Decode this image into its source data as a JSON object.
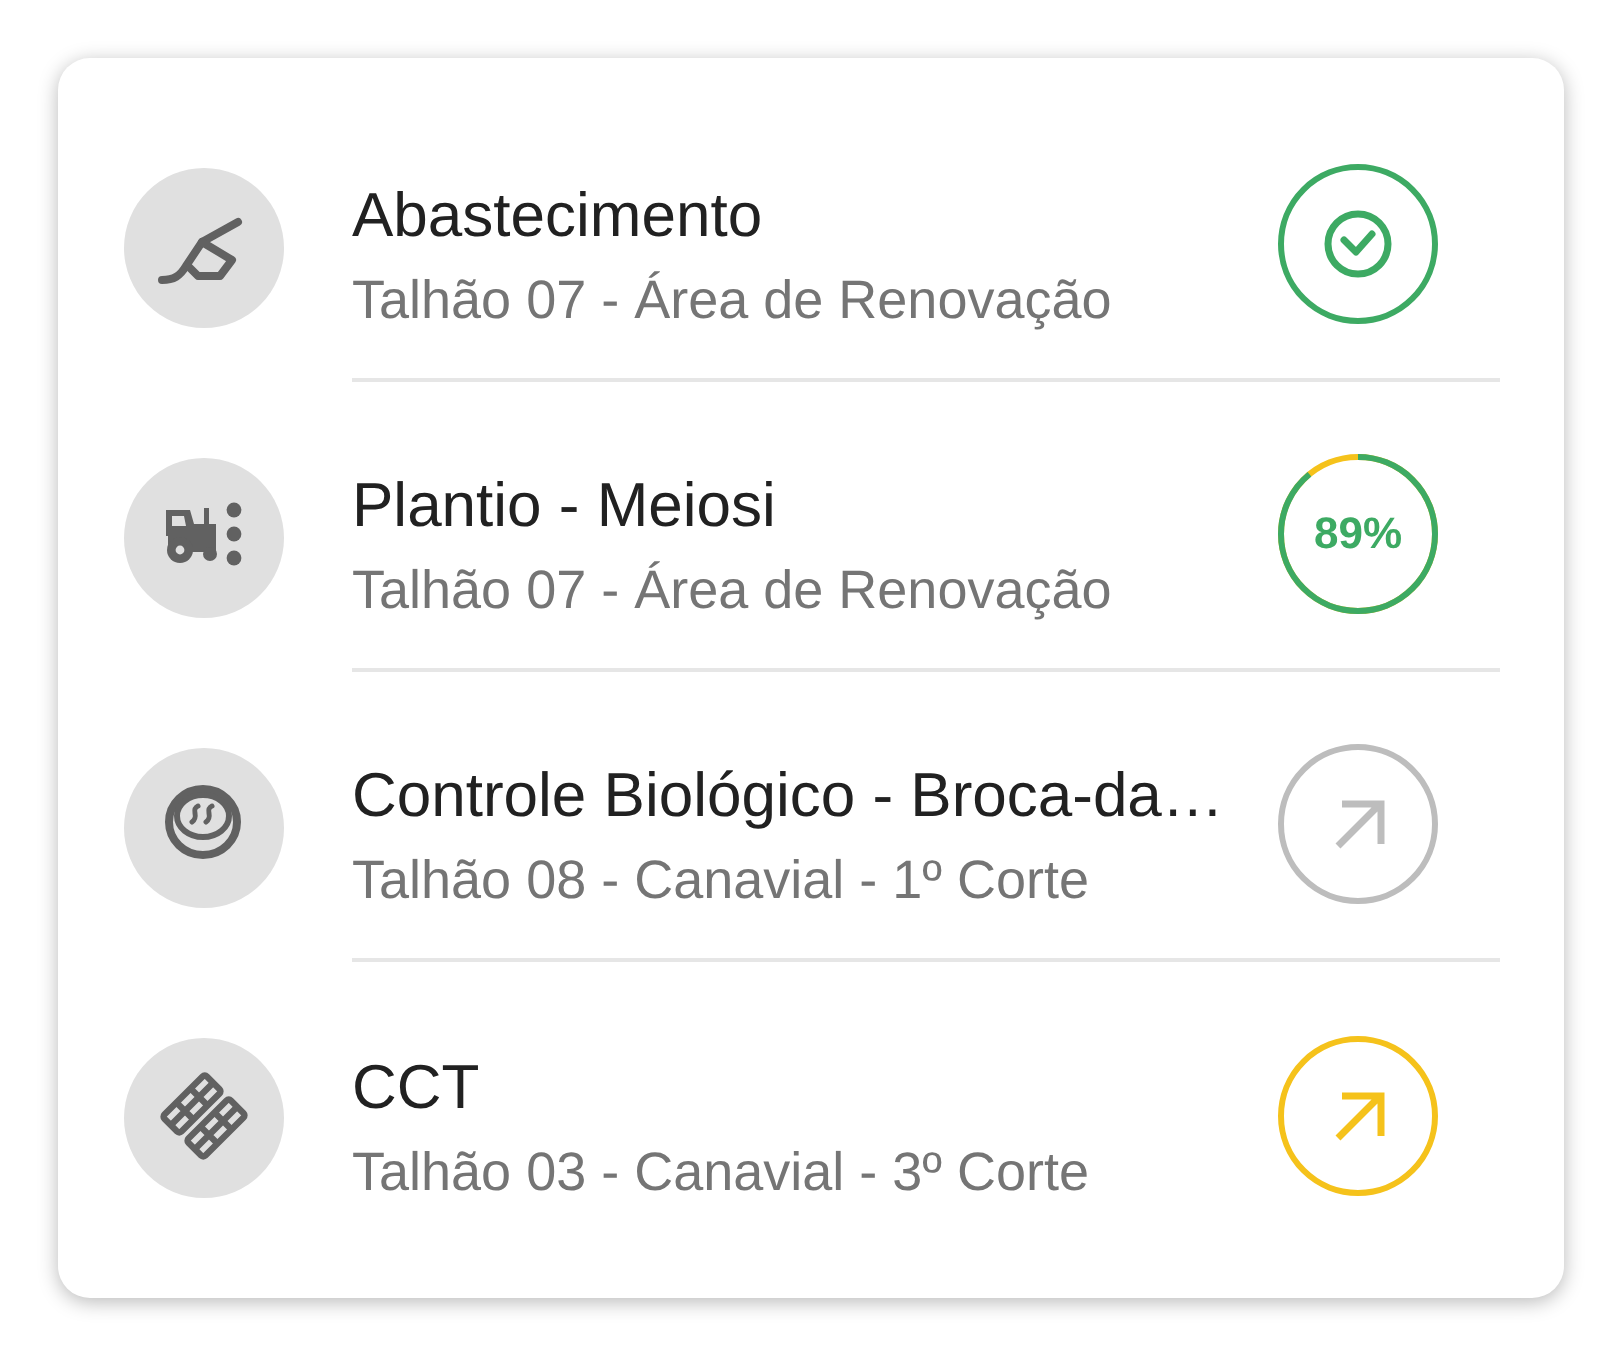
{
  "tasks": [
    {
      "kind": "fueling",
      "title": "Abastecimento",
      "subtitle": "Talhão 07 - Área de Renovação",
      "status": {
        "kind": "done",
        "color": "#3daa63"
      }
    },
    {
      "kind": "planting",
      "title": "Plantio - Meiosi",
      "subtitle": "Talhão 07 - Área de Renovação",
      "status": {
        "kind": "progress",
        "color": "#3daa63",
        "level": 0.89,
        "reading": "89%"
      }
    },
    {
      "kind": "biocontrol",
      "title": "Controle Biológico - Broca-da…",
      "subtitle": "Talhão 08 - Canavial - 1º Corte",
      "status": {
        "kind": "open",
        "color": "#bdbdbd"
      }
    },
    {
      "kind": "cct",
      "title": "CCT",
      "subtitle": "Talhão 03 - Canavial - 3º Corte",
      "status": {
        "kind": "open",
        "color": "#f5c21b"
      }
    }
  ]
}
